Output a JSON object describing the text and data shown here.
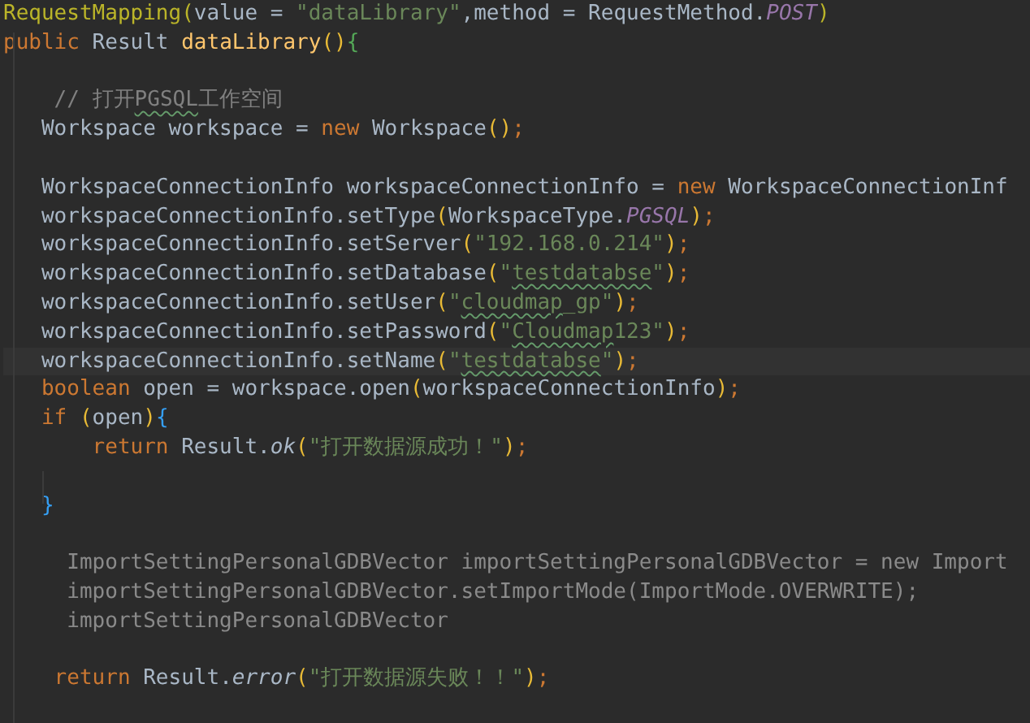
{
  "editor": {
    "lines": [
      {
        "kind": "code",
        "tokens": [
          {
            "text": "RequestMapping(",
            "kind": "annotation"
          },
          {
            "text": "value = ",
            "kind": "plain"
          },
          {
            "text": "\"dataLibrary\"",
            "kind": "string"
          },
          {
            "text": ",method = RequestMethod.",
            "kind": "plain"
          },
          {
            "text": "POST",
            "kind": "static"
          },
          {
            "text": ")",
            "kind": "annotation"
          }
        ]
      },
      {
        "kind": "code",
        "tokens": [
          {
            "text": "public",
            "kind": "keyword"
          },
          {
            "text": " Result ",
            "kind": "plain"
          },
          {
            "text": "dataLibrary",
            "kind": "declaration"
          },
          {
            "text": "()",
            "kind": "paren"
          },
          {
            "text": "{",
            "kind": "brace"
          }
        ]
      },
      {
        "kind": "blank"
      },
      {
        "kind": "code",
        "tokens": [
          {
            "text": "    // 打开",
            "kind": "comment"
          },
          {
            "text": "PGSQL",
            "kind": "comment",
            "typo": true
          },
          {
            "text": "工作空间",
            "kind": "comment"
          }
        ]
      },
      {
        "kind": "code",
        "tokens": [
          {
            "text": "   Workspace workspace = ",
            "kind": "plain"
          },
          {
            "text": "new",
            "kind": "keyword"
          },
          {
            "text": " Workspace",
            "kind": "plain"
          },
          {
            "text": "()",
            "kind": "paren"
          },
          {
            "text": ";",
            "kind": "punct"
          }
        ]
      },
      {
        "kind": "blank"
      },
      {
        "kind": "code",
        "tokens": [
          {
            "text": "   WorkspaceConnectionInfo workspaceConnectionInfo = ",
            "kind": "plain"
          },
          {
            "text": "new",
            "kind": "keyword"
          },
          {
            "text": " WorkspaceConnectionInf",
            "kind": "plain"
          }
        ]
      },
      {
        "kind": "code",
        "tokens": [
          {
            "text": "   workspaceConnectionInfo.setType",
            "kind": "plain"
          },
          {
            "text": "(",
            "kind": "paren"
          },
          {
            "text": "WorkspaceType.",
            "kind": "plain"
          },
          {
            "text": "PGSQL",
            "kind": "static"
          },
          {
            "text": ")",
            "kind": "paren"
          },
          {
            "text": ";",
            "kind": "punct"
          }
        ]
      },
      {
        "kind": "code",
        "tokens": [
          {
            "text": "   workspaceConnectionInfo.setServer",
            "kind": "plain"
          },
          {
            "text": "(",
            "kind": "paren"
          },
          {
            "text": "\"192.168.0.214\"",
            "kind": "string"
          },
          {
            "text": ")",
            "kind": "paren"
          },
          {
            "text": ";",
            "kind": "punct"
          }
        ]
      },
      {
        "kind": "code",
        "tokens": [
          {
            "text": "   workspaceConnectionInfo.setDatabase",
            "kind": "plain"
          },
          {
            "text": "(",
            "kind": "paren"
          },
          {
            "text": "\"",
            "kind": "string"
          },
          {
            "text": "testdatabse",
            "kind": "string",
            "typo": true
          },
          {
            "text": "\"",
            "kind": "string"
          },
          {
            "text": ")",
            "kind": "paren"
          },
          {
            "text": ";",
            "kind": "punct"
          }
        ]
      },
      {
        "kind": "code",
        "tokens": [
          {
            "text": "   workspaceConnectionInfo.setUser",
            "kind": "plain"
          },
          {
            "text": "(",
            "kind": "paren"
          },
          {
            "text": "\"",
            "kind": "string"
          },
          {
            "text": "cloudmap",
            "kind": "string",
            "typo": true
          },
          {
            "text": "_gp\"",
            "kind": "string"
          },
          {
            "text": ")",
            "kind": "paren"
          },
          {
            "text": ";",
            "kind": "punct"
          }
        ]
      },
      {
        "kind": "code",
        "tokens": [
          {
            "text": "   workspaceConnectionInfo.setPassword",
            "kind": "plain"
          },
          {
            "text": "(",
            "kind": "paren"
          },
          {
            "text": "\"",
            "kind": "string"
          },
          {
            "text": "Cloudmap",
            "kind": "string",
            "typo": true
          },
          {
            "text": "123\"",
            "kind": "string"
          },
          {
            "text": ")",
            "kind": "paren"
          },
          {
            "text": ";",
            "kind": "punct"
          }
        ]
      },
      {
        "kind": "code",
        "current": true,
        "tokens": [
          {
            "text": "   workspaceConnectionInfo.setName",
            "kind": "plain"
          },
          {
            "text": "(",
            "kind": "paren"
          },
          {
            "text": "\"",
            "kind": "string"
          },
          {
            "text": "testdatabse",
            "kind": "string",
            "typo": true
          },
          {
            "text": "\"",
            "kind": "string"
          },
          {
            "text": ")",
            "kind": "paren"
          },
          {
            "text": ";",
            "kind": "punct"
          }
        ]
      },
      {
        "kind": "code",
        "tokens": [
          {
            "text": "   boolean",
            "kind": "keyword"
          },
          {
            "text": " open = workspace.open",
            "kind": "plain"
          },
          {
            "text": "(",
            "kind": "paren"
          },
          {
            "text": "workspaceConnectionInfo",
            "kind": "plain"
          },
          {
            "text": ")",
            "kind": "paren"
          },
          {
            "text": ";",
            "kind": "punct"
          }
        ]
      },
      {
        "kind": "code",
        "tokens": [
          {
            "text": "   if ",
            "kind": "keyword"
          },
          {
            "text": "(",
            "kind": "paren"
          },
          {
            "text": "open",
            "kind": "plain"
          },
          {
            "text": ")",
            "kind": "paren"
          },
          {
            "text": "{",
            "kind": "brace2"
          }
        ]
      },
      {
        "kind": "code",
        "tokens": [
          {
            "text": "       return",
            "kind": "keyword"
          },
          {
            "text": " Result.",
            "kind": "plain"
          },
          {
            "text": "ok",
            "kind": "call"
          },
          {
            "text": "(",
            "kind": "paren"
          },
          {
            "text": "\"打开数据源成功！\"",
            "kind": "string"
          },
          {
            "text": ")",
            "kind": "paren"
          },
          {
            "text": ";",
            "kind": "punct"
          }
        ]
      },
      {
        "kind": "blank"
      },
      {
        "kind": "code",
        "tokens": [
          {
            "text": "   }",
            "kind": "brace2"
          }
        ]
      },
      {
        "kind": "blank"
      },
      {
        "kind": "code",
        "tokens": [
          {
            "text": "     ImportSettingPersonalGDBVector importSettingPersonalGDBVector = new Import",
            "kind": "unused"
          }
        ]
      },
      {
        "kind": "code",
        "tokens": [
          {
            "text": "     importSettingPersonalGDBVector.setImportMode(ImportMode.OVERWRITE);",
            "kind": "unused"
          }
        ]
      },
      {
        "kind": "code",
        "tokens": [
          {
            "text": "     importSettingPersonalGDBVector",
            "kind": "unused"
          }
        ]
      },
      {
        "kind": "blank"
      },
      {
        "kind": "code",
        "tokens": [
          {
            "text": "    return",
            "kind": "keyword"
          },
          {
            "text": " Result.",
            "kind": "plain"
          },
          {
            "text": "error",
            "kind": "call"
          },
          {
            "text": "(",
            "kind": "paren"
          },
          {
            "text": "\"打开数据源失败！！\"",
            "kind": "string"
          },
          {
            "text": ")",
            "kind": "paren"
          },
          {
            "text": ";",
            "kind": "punct"
          }
        ]
      }
    ]
  }
}
